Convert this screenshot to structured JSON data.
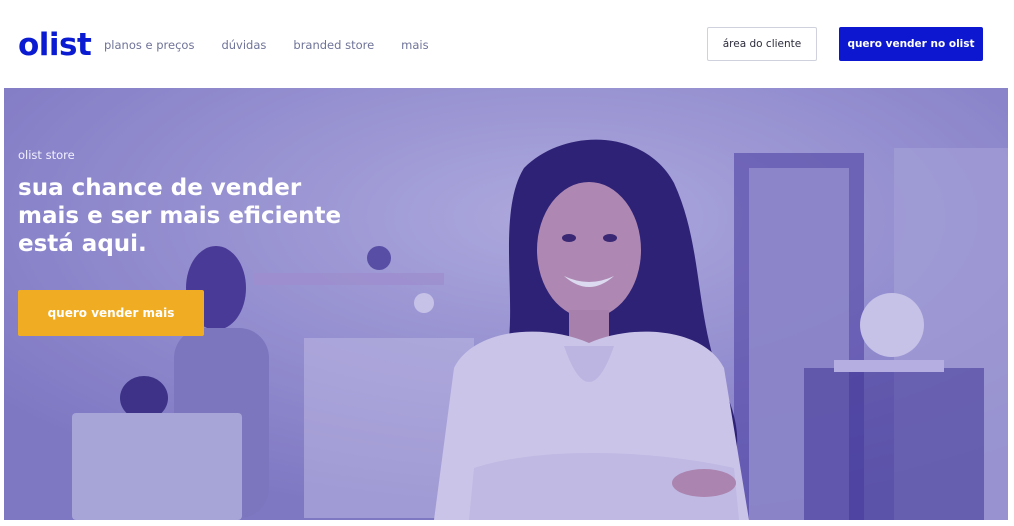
{
  "header": {
    "logo": "olist",
    "nav": [
      {
        "label": "planos e preços"
      },
      {
        "label": "dúvidas"
      },
      {
        "label": "branded store"
      },
      {
        "label": "mais"
      }
    ],
    "client_area_label": "área do cliente",
    "sell_label": "quero vender no olist"
  },
  "hero": {
    "eyebrow": "olist store",
    "headline": "sua chance de vender mais e ser mais eficiente está aqui.",
    "cta_label": "quero vender mais"
  },
  "colors": {
    "brand_blue": "#0d17cf",
    "cta_yellow": "#f0ad24",
    "hero_overlay": "#8f8bd0"
  }
}
